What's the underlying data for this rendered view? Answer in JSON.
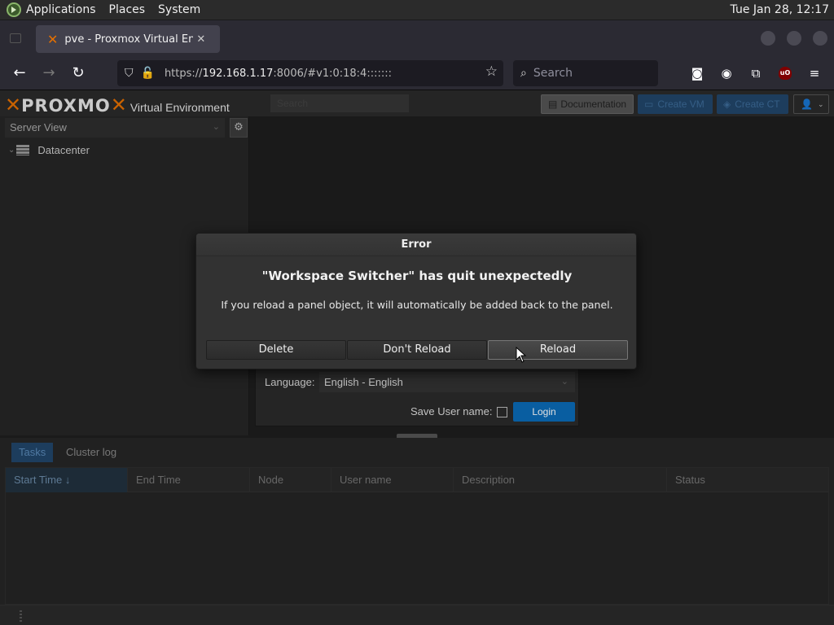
{
  "top_panel": {
    "menus": [
      "Applications",
      "Places",
      "System"
    ],
    "clock": "Tue Jan 28, 12:17"
  },
  "browser": {
    "tab_title": "pve - Proxmox Virtual Envir",
    "url_prefix": "https://",
    "url_host": "192.168.1.17",
    "url_rest": ":8006/#v1:0:18:4:::::::",
    "search_placeholder": "Search"
  },
  "pve": {
    "logo_text": "PROXMO",
    "logo_subtitle": "Virtual Environment",
    "search_placeholder": "Search",
    "buttons": {
      "documentation": "Documentation",
      "create_vm": "Create VM",
      "create_ct": "Create CT"
    },
    "server_view": "Server View",
    "tree_root": "Datacenter"
  },
  "login": {
    "language_label": "Language:",
    "language_value": "English - English",
    "save_username_label": "Save User name:",
    "login_button": "Login"
  },
  "tasks": {
    "tabs": [
      "Tasks",
      "Cluster log"
    ],
    "columns": [
      "Start Time",
      "End Time",
      "Node",
      "User name",
      "Description",
      "Status"
    ],
    "sort_indicator": "↓"
  },
  "dialog": {
    "title": "Error",
    "heading": "\"Workspace Switcher\" has quit unexpectedly",
    "message": "If you reload a panel object, it will automatically be added back to the panel.",
    "buttons": {
      "delete": "Delete",
      "dont_reload": "Don't Reload",
      "reload": "Reload"
    }
  },
  "colors": {
    "proxmox_orange": "#e57000",
    "login_blue": "#0b6bb8",
    "dialog_bg": "#323232"
  }
}
